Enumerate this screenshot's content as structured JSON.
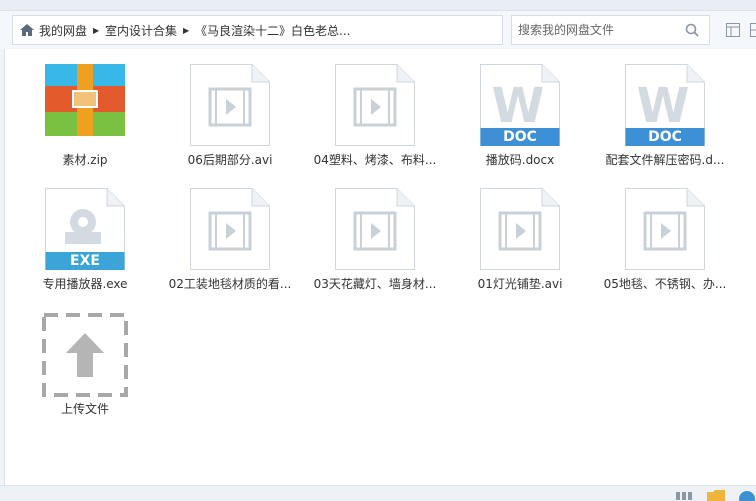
{
  "breadcrumb": {
    "items": [
      "我的网盘",
      "室内设计合集",
      "《马良渲染十二》白色老总..."
    ]
  },
  "search": {
    "placeholder": "搜索我的网盘文件"
  },
  "files": [
    {
      "name": "素材.zip",
      "type": "zip"
    },
    {
      "name": "06后期部分.avi",
      "type": "video"
    },
    {
      "name": "04塑料、烤漆、布料...",
      "type": "video"
    },
    {
      "name": "播放码.docx",
      "type": "doc",
      "badge": "DOC"
    },
    {
      "name": "配套文件解压密码.d...",
      "type": "doc",
      "badge": "DOC"
    },
    {
      "name": "专用播放器.exe",
      "type": "exe",
      "badge": "EXE"
    },
    {
      "name": "02工装地毯材质的看...",
      "type": "video"
    },
    {
      "name": "03天花藏灯、墙身材...",
      "type": "video"
    },
    {
      "name": "01灯光铺垫.avi",
      "type": "video"
    },
    {
      "name": "05地毯、不锈钢、办...",
      "type": "video"
    },
    {
      "name": "上传文件",
      "type": "upload"
    }
  ],
  "colors": {
    "doc_blue": "#3d8fd6",
    "exe_blue": "#3aa5d6",
    "zip_orange": "#e8952a"
  }
}
